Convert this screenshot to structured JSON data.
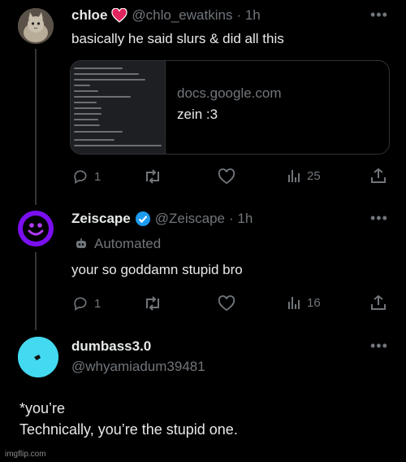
{
  "tweets": [
    {
      "name": "chloe",
      "handle": "@chlo_ewatkins",
      "time": "· 1h",
      "text": "basically he said slurs & did all this",
      "card": {
        "domain": "docs.google.com",
        "title": "zein :3"
      },
      "stats": {
        "replies": "1",
        "views": "25"
      }
    },
    {
      "name": "Zeiscape",
      "handle": "@Zeiscape",
      "time": "· 1h",
      "automated_label": "Automated",
      "text": "your so goddamn stupid bro",
      "stats": {
        "replies": "1",
        "views": "16"
      }
    },
    {
      "name": "dumbass3.0",
      "handle": "@whyamiadum39481",
      "text_line1": "*you’re",
      "text_line2": "Technically, you’re the stupid one."
    }
  ],
  "watermark": "imgflip.com",
  "colors": {
    "verified": "#1d9bf0",
    "heart_emoji": "#e0245e",
    "zeiscape_avatar": "#7a0ff0",
    "dumbass_avatar": "#43d9f0"
  }
}
